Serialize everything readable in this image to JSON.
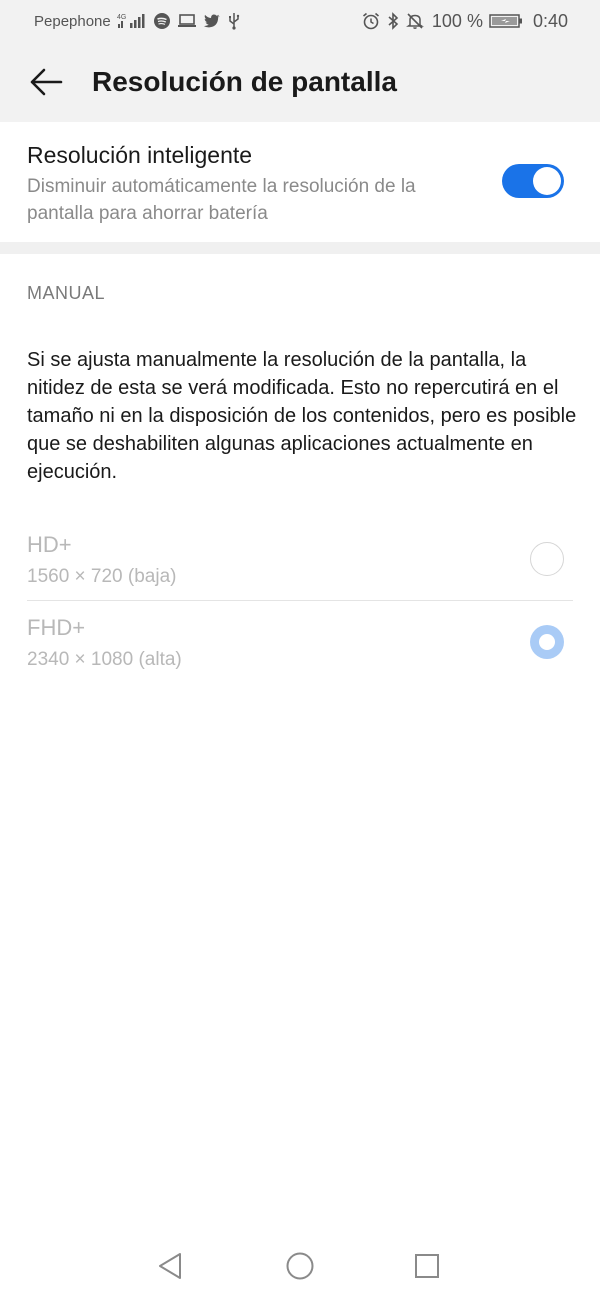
{
  "status_bar": {
    "carrier": "Pepephone",
    "network": "4G",
    "battery_percent": "100 %",
    "time": "0:40",
    "icons": [
      "signal-icon",
      "spotify-icon",
      "laptop-icon",
      "twitter-icon",
      "usb-icon",
      "alarm-icon",
      "bluetooth-icon",
      "mute-icon",
      "battery-charging-icon"
    ]
  },
  "header": {
    "title": "Resolución de pantalla",
    "back_icon": "arrow-back-icon"
  },
  "smart_resolution": {
    "title": "Resolución inteligente",
    "description": "Disminuir automáticamente la resolución de la pantalla para ahorrar batería",
    "enabled": true,
    "accent_color": "#1a73e8"
  },
  "manual": {
    "section_label": "MANUAL",
    "description": "Si se ajusta manualmente la resolución de la pantalla, la nitidez de esta se verá modificada. Esto no repercutirá en el tamaño ni en la disposición de los contenidos, pero es posible que se deshabiliten algunas aplicaciones actualmente en ejecución.",
    "options": [
      {
        "title": "HD+",
        "subtitle": "1560 × 720 (baja)",
        "selected": false
      },
      {
        "title": "FHD+",
        "subtitle": "2340 × 1080 (alta)",
        "selected": true
      }
    ]
  },
  "nav_bar": {
    "icons": [
      "back-triangle-icon",
      "home-circle-icon",
      "recents-square-icon"
    ]
  }
}
